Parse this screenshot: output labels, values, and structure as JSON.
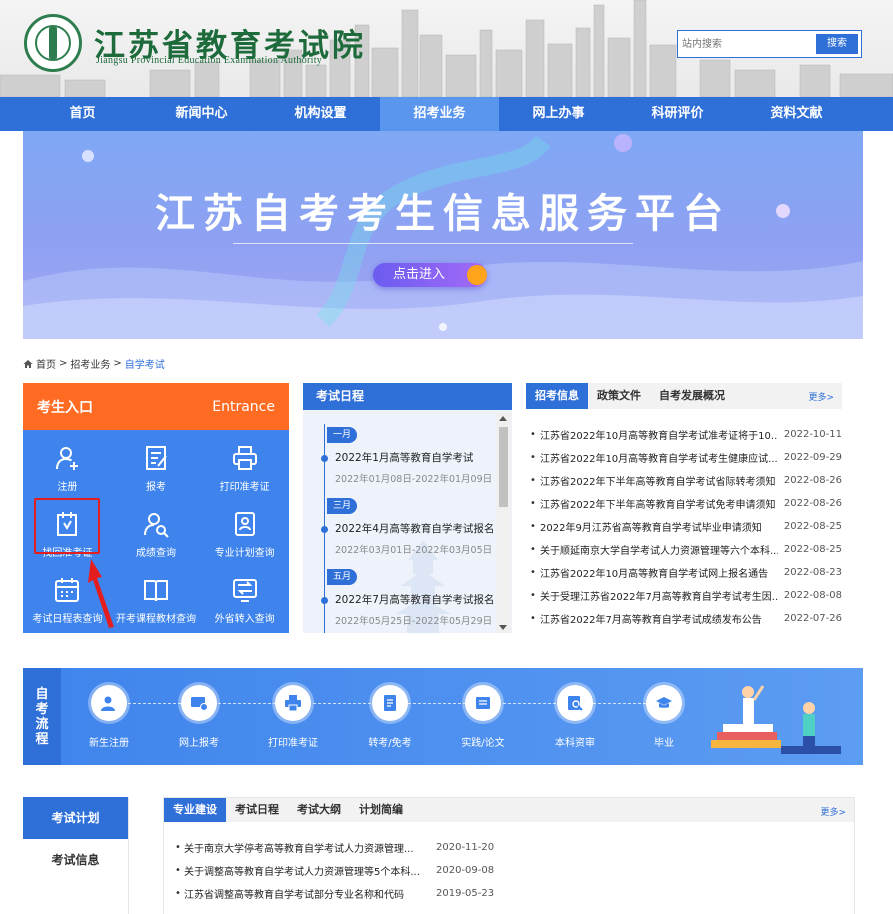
{
  "header": {
    "logo_cn": "江苏省教育考试院",
    "logo_en": "Jiangsu Provincial Education Examination Authority",
    "search_placeholder": "站内搜索",
    "search_button": "搜索"
  },
  "nav": {
    "items": [
      "首页",
      "新闻中心",
      "机构设置",
      "招考业务",
      "网上办事",
      "科研评价",
      "资料文献"
    ],
    "active": "招考业务"
  },
  "banner": {
    "title": "江苏自考考生信息服务平台",
    "button": "点击进入"
  },
  "breadcrumb": [
    "首页",
    ">",
    "招考业务",
    ">",
    "自学考试"
  ],
  "entrance": {
    "title": "考生入口",
    "title_en": "Entrance",
    "items": [
      {
        "label": "注册",
        "icon": "user-add-icon"
      },
      {
        "label": "报考",
        "icon": "edit-doc-icon"
      },
      {
        "label": "打印准考证",
        "icon": "printer-icon"
      },
      {
        "label": "找回准考证",
        "icon": "recover-doc-icon"
      },
      {
        "label": "成绩查询",
        "icon": "search-user-icon"
      },
      {
        "label": "专业计划查询",
        "icon": "id-card-icon"
      },
      {
        "label": "考试日程表查询",
        "icon": "calendar-icon"
      },
      {
        "label": "开考课程教材查询",
        "icon": "book-icon"
      },
      {
        "label": "外省转入查询",
        "icon": "transfer-icon"
      }
    ]
  },
  "schedule": {
    "title": "考试日程",
    "items": [
      {
        "month": "一月",
        "title": "2022年1月高等教育自学考试",
        "date": "2022年01月08日-2022年01月09日"
      },
      {
        "month": "三月",
        "title": "2022年4月高等教育自学考试报名",
        "date": "2022年03月01日-2022年03月05日"
      },
      {
        "month": "五月",
        "title": "2022年7月高等教育自学考试报名",
        "date": "2022年05月25日-2022年05月29日"
      }
    ]
  },
  "news": {
    "tabs": [
      "招考信息",
      "政策文件",
      "自考发展概况"
    ],
    "more": "更多>",
    "items": [
      {
        "title": "江苏省2022年10月高等教育自学考试准考证将于10...",
        "date": "2022-10-11"
      },
      {
        "title": "江苏省2022年10月高等教育自学考试考生健康应试...",
        "date": "2022-09-29"
      },
      {
        "title": "江苏省2022年下半年高等教育自学考试省际转考须知",
        "date": "2022-08-26"
      },
      {
        "title": "江苏省2022年下半年高等教育自学考试免考申请须知",
        "date": "2022-08-26"
      },
      {
        "title": "2022年9月江苏省高等教育自学考试毕业申请须知",
        "date": "2022-08-25"
      },
      {
        "title": "关于顺延南京大学自学考试人力资源管理等六个本科...",
        "date": "2022-08-25"
      },
      {
        "title": "江苏省2022年10月高等教育自学考试网上报名通告",
        "date": "2022-08-23"
      },
      {
        "title": "关于受理江苏省2022年7月高等教育自学考试考生因...",
        "date": "2022-08-08"
      },
      {
        "title": "江苏省2022年7月高等教育自学考试成绩发布公告",
        "date": "2022-07-26"
      }
    ]
  },
  "flow": {
    "label": "自考流程",
    "steps": [
      {
        "label": "新生注册",
        "icon": "register-icon"
      },
      {
        "label": "网上报考",
        "icon": "online-apply-icon"
      },
      {
        "label": "打印准考证",
        "icon": "printer-icon"
      },
      {
        "label": "转考/免考",
        "icon": "document-icon"
      },
      {
        "label": "实践/论文",
        "icon": "paper-icon"
      },
      {
        "label": "本科资审",
        "icon": "review-icon"
      },
      {
        "label": "毕业",
        "icon": "graduation-cap-icon"
      }
    ]
  },
  "side_tabs": [
    "考试计划",
    "考试信息"
  ],
  "plan": {
    "tabs": [
      "专业建设",
      "考试日程",
      "考试大纲",
      "计划简编"
    ],
    "more": "更多>",
    "items": [
      {
        "title": "关于南京大学停考高等教育自学考试人力资源管理...",
        "date": "2020-11-20"
      },
      {
        "title": "关于调整高等教育自学考试人力资源管理等5个本科...",
        "date": "2020-09-08"
      },
      {
        "title": "江苏省调整高等教育自学考试部分专业名称和代码",
        "date": "2019-05-23"
      }
    ]
  },
  "colors": {
    "primary": "#2f6fd8",
    "entrance_head": "#ff6b22",
    "highlight": "#e41e1e",
    "logo_green": "#1d6b3b"
  }
}
